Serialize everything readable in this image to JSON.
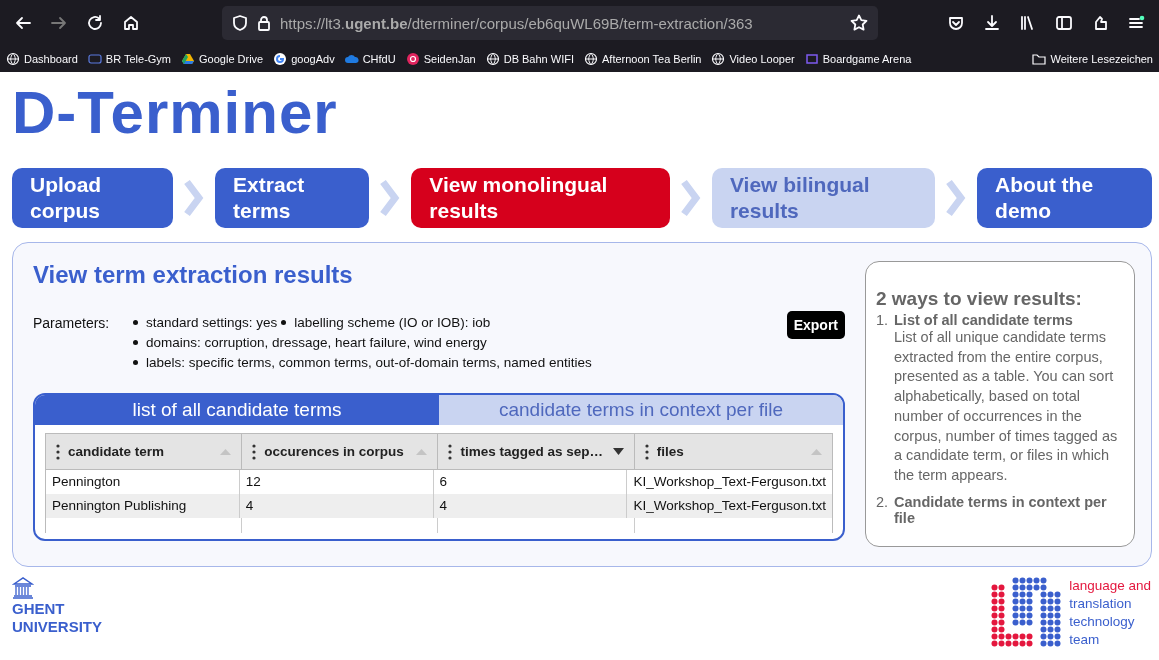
{
  "browser": {
    "url": "https://lt3.**ugent.be**/dterminer/corpus/eb6quWL69B/term-extraction/363",
    "bookmarks": [
      {
        "kind": "globe",
        "label": "Dashboard"
      },
      {
        "kind": "br",
        "label": "BR Tele-Gym"
      },
      {
        "kind": "drive",
        "label": "Google Drive"
      },
      {
        "kind": "google",
        "label": "googAdv"
      },
      {
        "kind": "cloud",
        "label": "CHfdU"
      },
      {
        "kind": "seiden",
        "label": "SeidenJan"
      },
      {
        "kind": "globe",
        "label": "DB Bahn WIFI"
      },
      {
        "kind": "globe",
        "label": "Afternoon Tea Berlin"
      },
      {
        "kind": "globe",
        "label": "Video Looper"
      },
      {
        "kind": "game",
        "label": "Boardgame Arena"
      }
    ],
    "other_bookmarks": "Weitere Lesezeichen"
  },
  "app_title": "D-Terminer",
  "steps": [
    {
      "label": "Upload corpus",
      "selected": false,
      "disabled": false
    },
    {
      "label": "Extract terms",
      "selected": false,
      "disabled": false
    },
    {
      "label": "View monolingual results",
      "selected": true,
      "disabled": false
    },
    {
      "label": "View bilingual results",
      "selected": false,
      "disabled": true
    },
    {
      "label": "About the demo",
      "selected": false,
      "disabled": false
    }
  ],
  "results": {
    "title": "View term extraction results",
    "parameters_label": "Parameters:",
    "parameters": [
      "standard settings: yes",
      "labelling scheme (IO or IOB): iob",
      "domains: corruption, dressage, heart failure, wind energy",
      "labels: specific terms, common terms, out-of-domain terms, named entities"
    ],
    "export_button": "Export",
    "tabs": [
      {
        "label": "list of all candidate terms",
        "selected": true
      },
      {
        "label": "candidate terms in context per file",
        "selected": false
      }
    ],
    "table": {
      "columns": [
        {
          "label": "candidate term",
          "sorted": false
        },
        {
          "label": "occurences in corpus",
          "sorted": false
        },
        {
          "label": "times tagged as sep…",
          "sorted": true
        },
        {
          "label": "files",
          "sorted": false
        }
      ],
      "rows": [
        [
          "Pennington",
          "12",
          "6",
          "KI_Workshop_Text-Ferguson.txt"
        ],
        [
          "Pennington Publishing",
          "4",
          "4",
          "KI_Workshop_Text-Ferguson.txt"
        ]
      ]
    }
  },
  "help": {
    "title": "2 ways to view results:",
    "items": [
      {
        "number": "1.",
        "title": "List of all candidate terms",
        "text": "List of all unique candidate terms extracted from the entire corpus, presented as a table. You can sort alphabetically, based on total number of occurrences in the corpus, number of times tagged as a candidate term, or files in which the term appears."
      },
      {
        "number": "2.",
        "title": "Candidate terms in context per file"
      }
    ]
  },
  "footer": {
    "university": [
      "GHENT",
      "UNIVERSITY"
    ],
    "team": [
      {
        "text": "language and",
        "color": "#e4173e"
      },
      {
        "text": "translation",
        "color": "#3a5fcd"
      },
      {
        "text": "technology",
        "color": "#3a5fcd"
      },
      {
        "text": "team",
        "color": "#3a5fcd"
      }
    ]
  }
}
